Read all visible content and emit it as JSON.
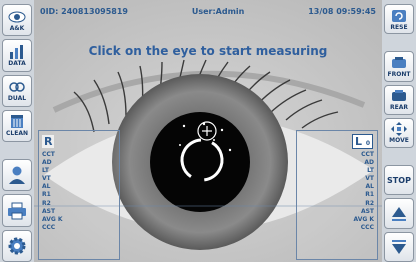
{
  "status": {
    "patient_id": "0ID: 240813095819",
    "user": "User:Admin",
    "datetime": "13/08 09:59:45"
  },
  "instruction": "Click on the eye to start measuring",
  "left_toolbar": [
    {
      "label": "A&K",
      "icon": "eye-icon"
    },
    {
      "label": "DATA",
      "icon": "bar-chart-icon"
    },
    {
      "label": "DUAL",
      "icon": "dual-eye-icon"
    },
    {
      "label": "CLEAN",
      "icon": "clean-icon"
    },
    {
      "label": "",
      "icon": "user-icon"
    },
    {
      "label": "",
      "icon": "printer-icon"
    },
    {
      "label": "",
      "icon": "gear-icon"
    }
  ],
  "right_toolbar": [
    {
      "label": "RESE",
      "icon": "reset-icon"
    },
    {
      "label": "FRONT",
      "icon": "front-icon"
    },
    {
      "label": "REAR",
      "icon": "rear-icon"
    },
    {
      "label": "MOVE",
      "icon": "move-arrows-icon"
    },
    {
      "label": "STOP",
      "icon": ""
    },
    {
      "label": "",
      "icon": "chevron-up-icon"
    },
    {
      "label": "",
      "icon": "chevron-down-icon"
    }
  ],
  "left_panel": {
    "eye": "R",
    "sub": "",
    "fields": [
      "CCT",
      "AD",
      "LT",
      "VT",
      "AL",
      "R1",
      "R2",
      "AST",
      "AVG K",
      "CCC"
    ]
  },
  "right_panel": {
    "eye": "L",
    "sub": "0",
    "fields": [
      "CCT",
      "AD",
      "LT",
      "VT",
      "AL",
      "R1",
      "R2",
      "AST",
      "AVG K",
      "CCC"
    ]
  }
}
